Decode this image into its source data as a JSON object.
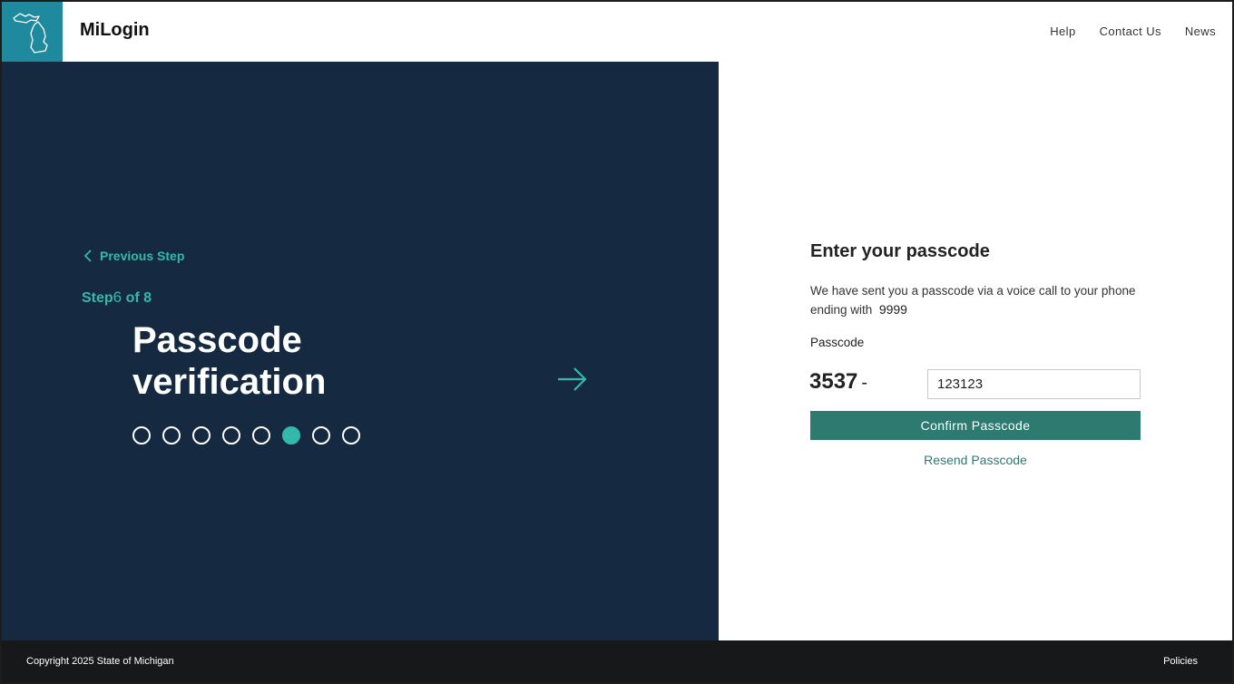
{
  "header": {
    "brand": "MiLogin",
    "nav": [
      "Help",
      "Contact Us",
      "News"
    ]
  },
  "left": {
    "previous_step": "Previous Step",
    "step_prefix": "Step",
    "step_number": "6",
    "step_suffix": "of 8",
    "title_line1": "Passcode",
    "title_line2": "verification",
    "total_steps": 8,
    "current_step": 6
  },
  "right": {
    "title": "Enter your passcode",
    "description": "We have sent you a passcode via a voice call to your phone ending with",
    "phone_last_digits": "9999",
    "passcode_label": "Passcode",
    "passcode_prefix": "3537",
    "passcode_value": "123123",
    "confirm_label": "Confirm Passcode",
    "resend_label": "Resend Passcode"
  },
  "footer": {
    "copyright": "Copyright 2025 State of Michigan",
    "policies": "Policies"
  },
  "colors": {
    "navy": "#152a40",
    "teal_accent": "#34b8ac",
    "button": "#2c7a70",
    "logo_bg": "#1f8a9e",
    "footer": "#161819"
  }
}
